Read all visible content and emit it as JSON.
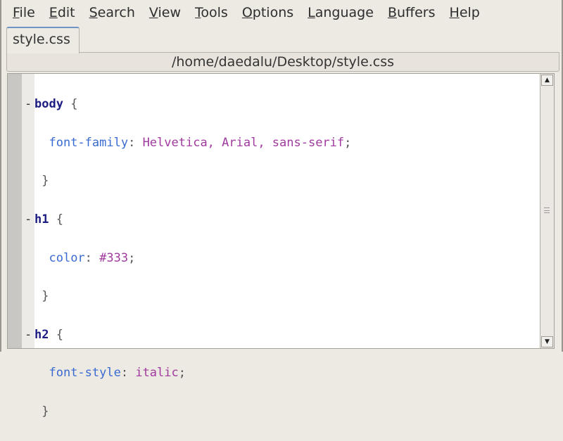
{
  "menu": [
    {
      "label": "File",
      "u": "F",
      "rest": "ile"
    },
    {
      "label": "Edit",
      "u": "E",
      "rest": "dit"
    },
    {
      "label": "Search",
      "u": "S",
      "rest": "earch"
    },
    {
      "label": "View",
      "u": "V",
      "rest": "iew"
    },
    {
      "label": "Tools",
      "u": "T",
      "rest": "ools"
    },
    {
      "label": "Options",
      "u": "O",
      "rest": "ptions"
    },
    {
      "label": "Language",
      "u": "L",
      "rest": "anguage"
    },
    {
      "label": "Buffers",
      "u": "B",
      "rest": "uffers"
    },
    {
      "label": "Help",
      "u": "H",
      "rest": "elp"
    }
  ],
  "tab": {
    "label": "style.css"
  },
  "path": "/home/daedalu/Desktop/style.css",
  "code": {
    "l1": {
      "sel": "body",
      "brace": " {"
    },
    "l2": {
      "prop": "font-family",
      "colon": ": ",
      "val": "Helvetica, Arial, sans-serif",
      "semi": ";"
    },
    "l3": "}",
    "l4": {
      "sel": "h1",
      "brace": " {"
    },
    "l5": {
      "prop": "color",
      "colon": ": ",
      "val": "#333",
      "semi": ";"
    },
    "l6": "}",
    "l7": {
      "sel": "h2",
      "brace": " {"
    },
    "l8": {
      "prop": "font-style",
      "colon": ": ",
      "val": "italic",
      "semi": ";"
    },
    "l9": "}"
  }
}
